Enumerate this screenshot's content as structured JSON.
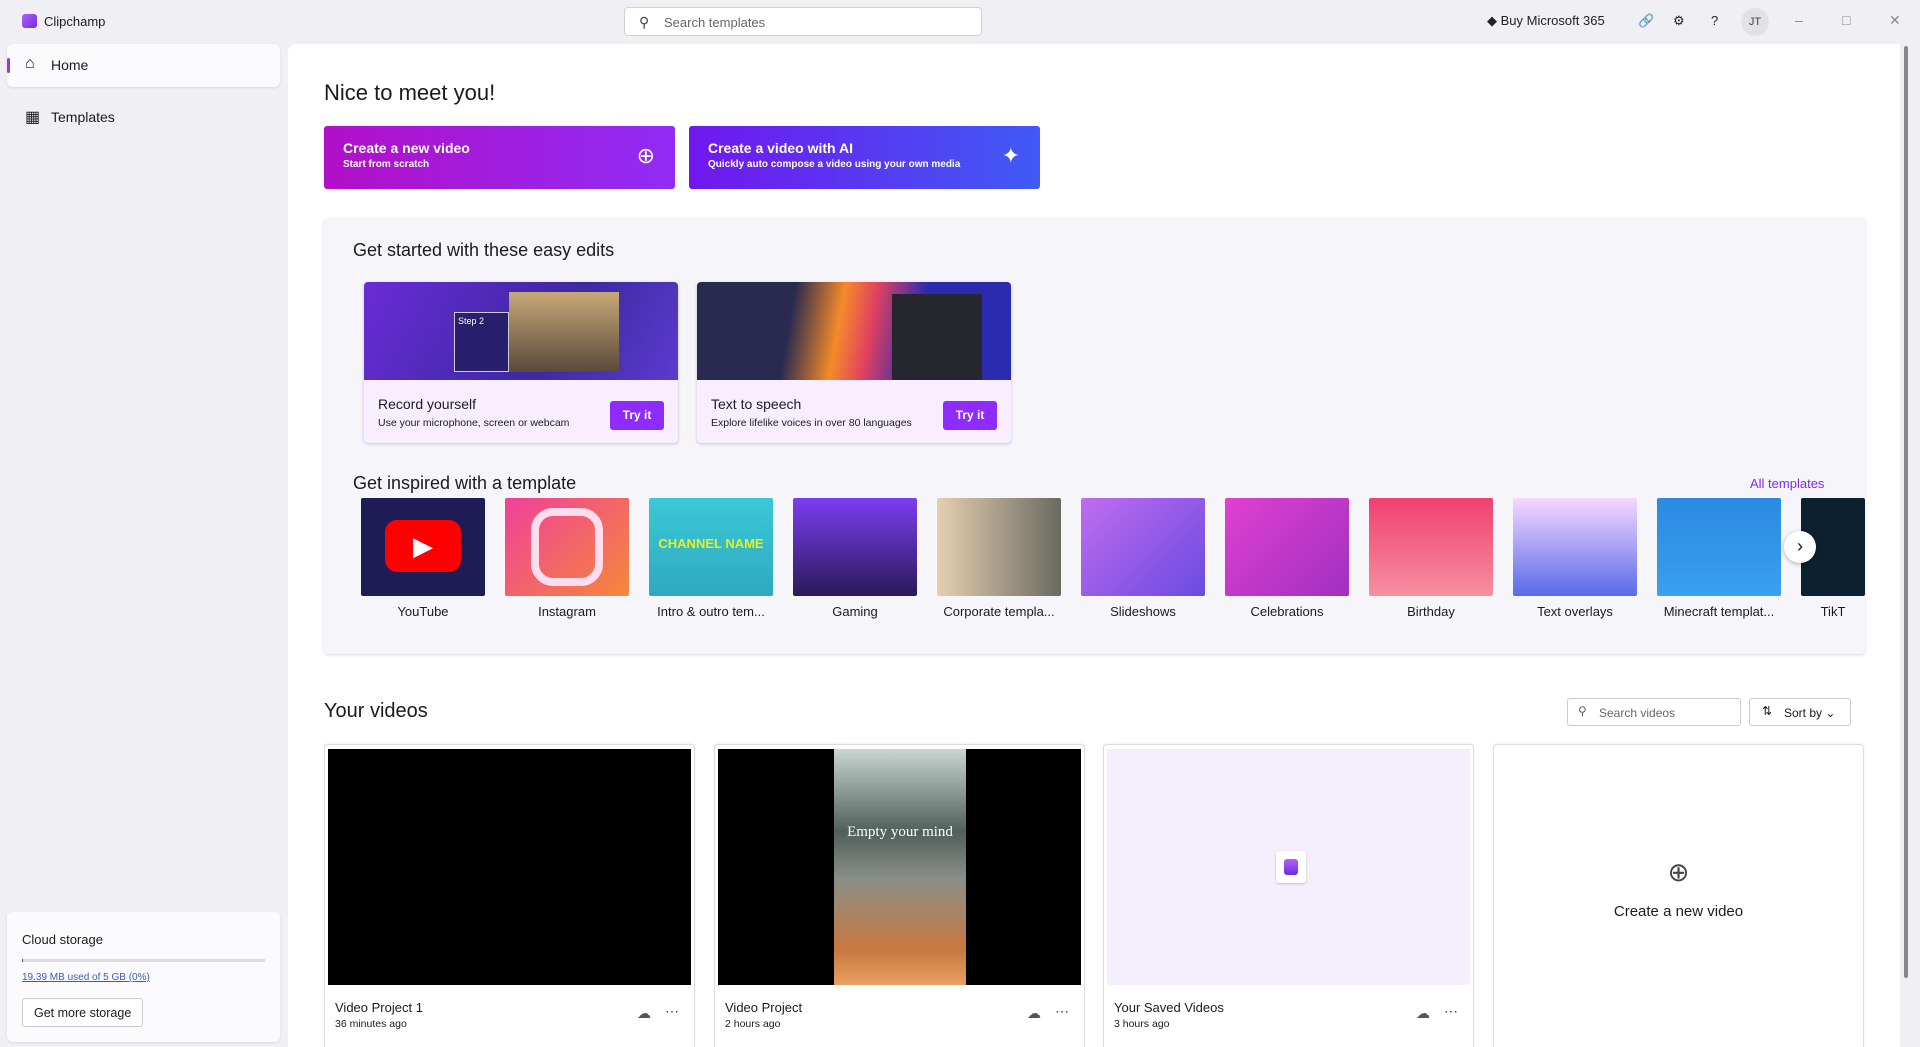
{
  "app": {
    "name": "Clipchamp",
    "search_placeholder": "Search templates",
    "buy": "Buy Microsoft 365",
    "avatar": "JT",
    "accent": "#8e2bff"
  },
  "sidebar": {
    "items": [
      {
        "label": "Home",
        "icon": "home-icon"
      },
      {
        "label": "Templates",
        "icon": "templates-icon"
      }
    ],
    "storage": {
      "title": "Cloud storage",
      "usage": "19.39 MB used of 5 GB (0%)",
      "percent": 0.4,
      "button": "Get more storage"
    }
  },
  "main": {
    "greeting": "Nice to meet you!",
    "cta": [
      {
        "title": "Create a new video",
        "subtitle": "Start from scratch"
      },
      {
        "title": "Create a video with AI",
        "subtitle": "Quickly auto compose a video using your own media"
      }
    ],
    "easy_edits": {
      "title": "Get started with these easy edits",
      "cards": [
        {
          "title": "Record yourself",
          "subtitle": "Use your microphone, screen or webcam",
          "button": "Try it",
          "image_text": "Step 2"
        },
        {
          "title": "Text to speech",
          "subtitle": "Explore lifelike voices in over 80 languages",
          "button": "Try it"
        }
      ]
    },
    "templates": {
      "title": "Get inspired with a template",
      "all": "All templates",
      "items": [
        "YouTube",
        "Instagram",
        "Intro & outro tem...",
        "Gaming",
        "Corporate templa...",
        "Slideshows",
        "Celebrations",
        "Birthday",
        "Text overlays",
        "Minecraft templat...",
        "TikT"
      ],
      "intro_thumb_text": "CHANNEL NAME"
    },
    "videos": {
      "title": "Your videos",
      "search_placeholder": "Search videos",
      "sort": "Sort by",
      "create": "Create a new video",
      "items": [
        {
          "name": "Video Project 1",
          "time": "36 minutes ago"
        },
        {
          "name": "Video Project",
          "time": "2 hours ago",
          "thumb_text": "Empty your mind"
        },
        {
          "name": "Your Saved Videos",
          "time": "3 hours ago"
        }
      ]
    }
  }
}
